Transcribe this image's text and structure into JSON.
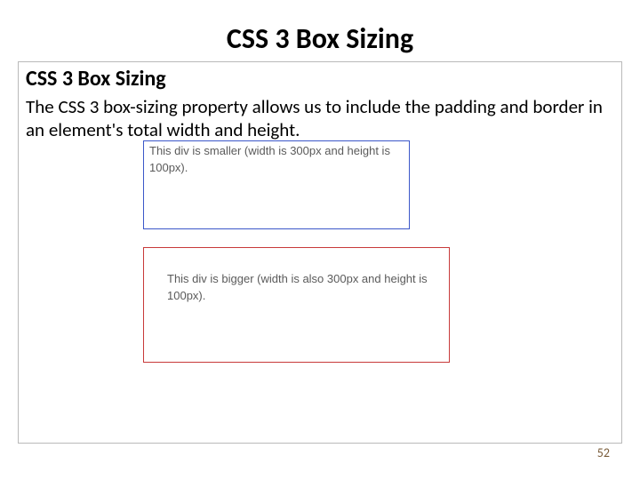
{
  "title": "CSS 3 Box Sizing",
  "subheading": "CSS 3 Box Sizing",
  "paragraph": "The CSS 3 box-sizing property allows us to include the padding and border in an element's total width and height.",
  "demo": {
    "box1": "This div is smaller (width is 300px and height is 100px).",
    "box2": "This div is bigger (width is also 300px and height is 100px)."
  },
  "page_number": "52"
}
